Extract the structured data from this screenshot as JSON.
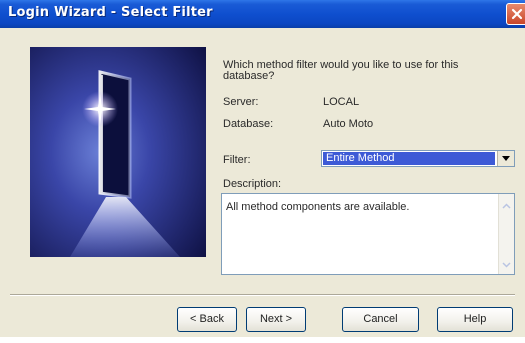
{
  "window": {
    "title": "Login Wizard - Select Filter"
  },
  "prompt": "Which method filter would you like to use for this database?",
  "fields": {
    "server_label": "Server:",
    "server_value": "LOCAL",
    "database_label": "Database:",
    "database_value": "Auto Moto"
  },
  "filter": {
    "label": "Filter:",
    "selected": "Entire Method"
  },
  "description": {
    "label": "Description:",
    "text": "All method components are available."
  },
  "buttons": {
    "back": "< Back",
    "next": "Next >",
    "cancel": "Cancel",
    "help": "Help"
  },
  "icons": {
    "close": "close-icon",
    "dropdown": "chevron-down-icon",
    "scroll_up": "scroll-up-arrow-icon",
    "scroll_down": "scroll-down-arrow-icon"
  },
  "colors": {
    "titlebar": "#0f4fcf",
    "selection": "#3d5ad6",
    "dialog_bg": "#ece9d8",
    "close_button": "#d75a3c"
  }
}
